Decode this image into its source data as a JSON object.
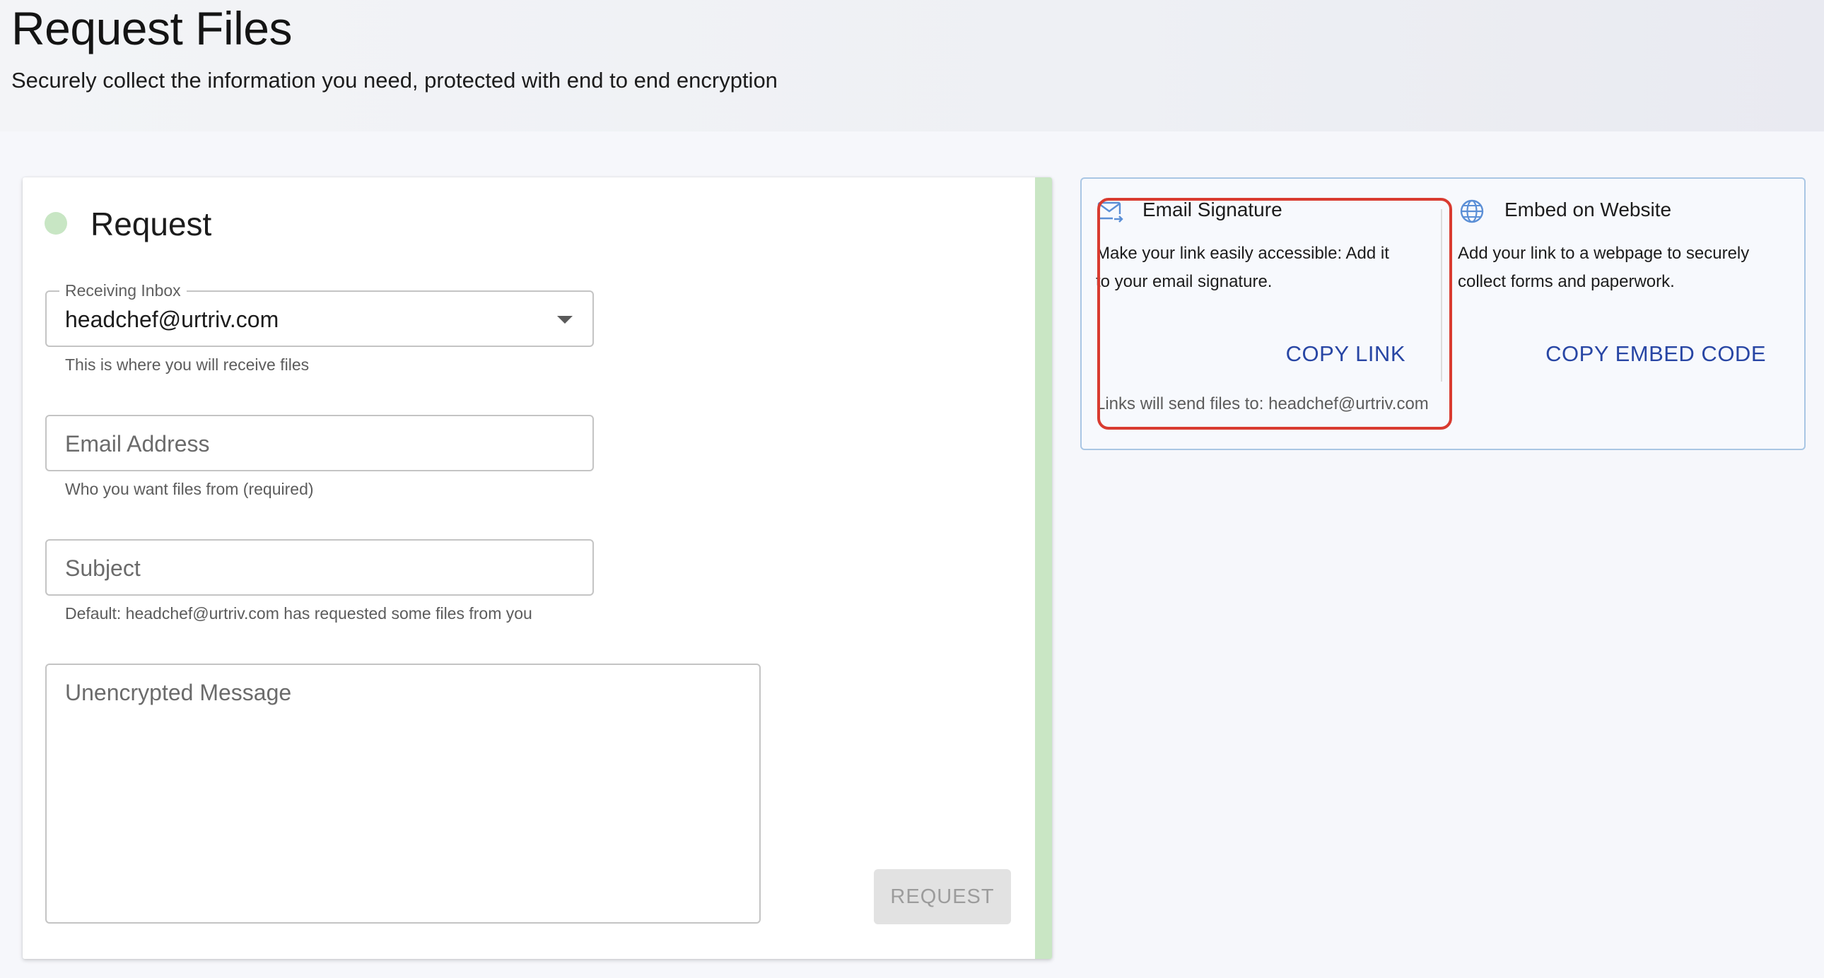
{
  "header": {
    "title": "Request Files",
    "subtitle": "Securely collect the information you need, protected with end to end encryption"
  },
  "request_card": {
    "title": "Request",
    "receiving_inbox": {
      "label": "Receiving Inbox",
      "value": "headchef@urtriv.com",
      "helper": "This is where you will receive files"
    },
    "email_address": {
      "placeholder": "Email Address",
      "helper": "Who you want files from (required)"
    },
    "subject": {
      "placeholder": "Subject",
      "helper": "Default: headchef@urtriv.com has requested some files from you"
    },
    "message": {
      "placeholder": "Unencrypted Message"
    },
    "request_button_label": "REQUEST"
  },
  "share_panel": {
    "email_signature": {
      "icon": "email-forward-icon",
      "title": "Email Signature",
      "description": "Make your link easily accessible: Add it to your email signature.",
      "action_label": "COPY LINK",
      "footnote": "Links will send files to: headchef@urtriv.com"
    },
    "embed_website": {
      "icon": "globe-icon",
      "title": "Embed on Website",
      "description": "Add your link to a webpage to securely collect forms and paperwork.",
      "action_label": "COPY EMBED CODE"
    }
  },
  "colors": {
    "accent_green": "#c9e6c4",
    "link_blue": "#2846a4",
    "highlight_red": "#d93b30",
    "panel_border": "#a9c6e4"
  }
}
